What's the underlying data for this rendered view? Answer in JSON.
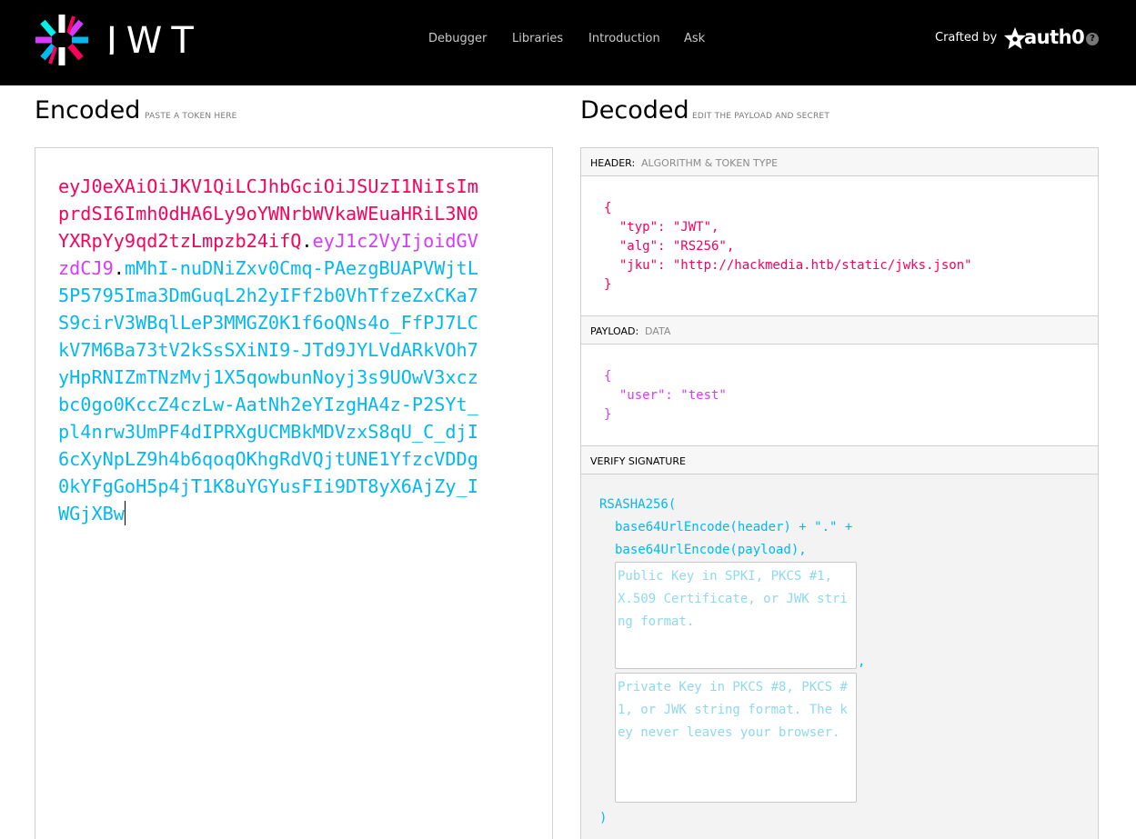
{
  "nav": {
    "brand": "JWT",
    "links": [
      "Debugger",
      "Libraries",
      "Introduction",
      "Ask"
    ],
    "crafted_by": "Crafted by",
    "crafted_brand": "auth0",
    "help": "?"
  },
  "encoded": {
    "title": "Encoded",
    "subtitle": "PASTE A TOKEN HERE",
    "token_header": "eyJ0eXAiOiJKV1QiLCJhbGciOiJSUzI1NiIsImprdSI6Imh0dHA6Ly9oYWNrbWVkaWEuaHRiL3N0YXRpYy9qd2tzLmpzb24ifQ",
    "token_payload": "eyJ1c2VyIjoidGVzdCJ9",
    "token_signature": "mMhI-nuDNiZxv0Cmq-PAezgBUAPVWjtL5P5795Ima3DmGuqL2h2yIFf2b0VhTfzeZxCKa7S9cirV3WBqlLeP3MMGZ0K1f6oQNs4o_FfPJ7LCkV7M6Ba73tV2kSsSXiNI9-JTd9JYLVdARkVOh7yHpRNIZmTNzMvj1X5qowbunNoyj3s9UOwV3xczbc0go0KccZ4czLw-AatNh2eYIzgHA4z-P2SYt_pl4nrw3UmPF4dIPRXgUCMBkMDVzxS8qU_C_djI6cXyNpLZ9h4b6qoqOKhgRdVQjtUNE1YfzcVDDg0kYFgGoH5p4jT1K8uYGYusFIi9DT8yX6AjZy_IWGjXBw",
    "dot": "."
  },
  "decoded": {
    "title": "Decoded",
    "subtitle": "EDIT THE PAYLOAD AND SECRET",
    "header_label": "HEADER:",
    "header_sub": "ALGORITHM & TOKEN TYPE",
    "header_json": "{\n  \"typ\": \"JWT\",\n  \"alg\": \"RS256\",\n  \"jku\": \"http://hackmedia.htb/static/jwks.json\"\n}",
    "payload_label": "PAYLOAD:",
    "payload_sub": "DATA",
    "payload_json": "{\n  \"user\": \"test\"\n}",
    "verify_label": "VERIFY SIGNATURE",
    "verify_fn": "RSASHA256(",
    "verify_line1": "base64UrlEncode(header) + \".\" +",
    "verify_line2": "base64UrlEncode(payload),",
    "public_key_placeholder": "Public Key in SPKI, PKCS #1, X.509 Certificate, or JWK string format.",
    "private_key_placeholder": "Private Key in PKCS #8, PKCS #1, or JWK string format. The key never leaves your browser.",
    "comma": ",",
    "close_paren": ")"
  },
  "colors": {
    "header": "#fb015b",
    "payload": "#d63aff",
    "signature": "#00b9f1"
  }
}
